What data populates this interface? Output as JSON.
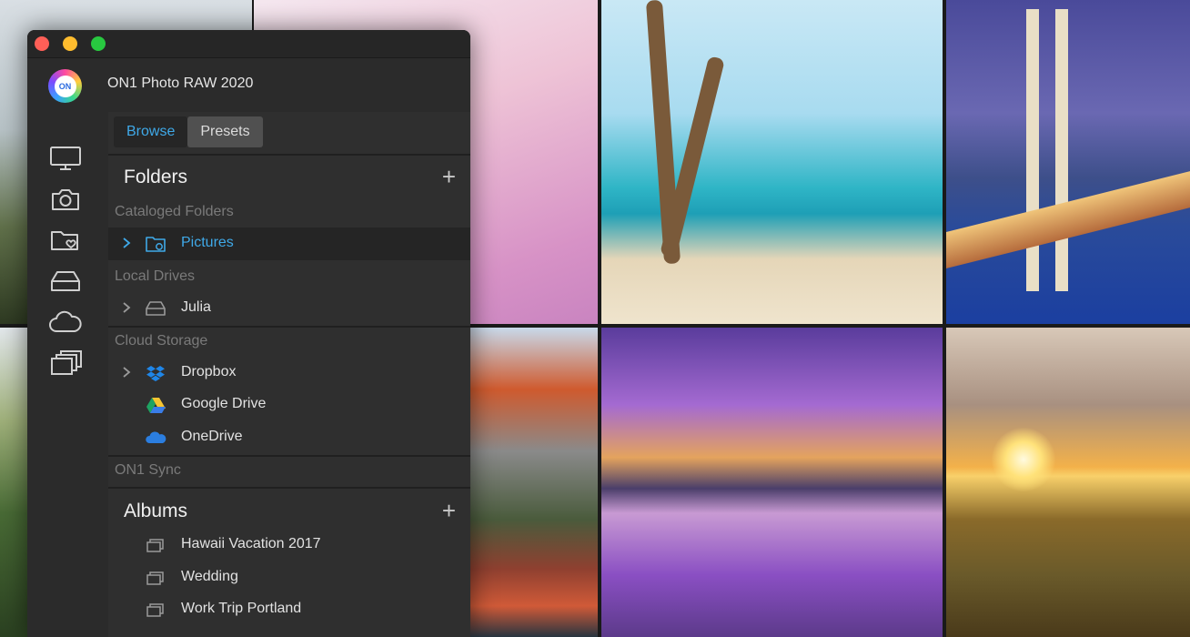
{
  "app": {
    "title": "ON1 Photo RAW 2020",
    "logo_text": "ON"
  },
  "colors": {
    "accent": "#3fa9e8",
    "window_bg": "#2b2b2b",
    "panel_bg": "#2f2f2f"
  },
  "tabs": [
    {
      "label": "Browse",
      "active": true
    },
    {
      "label": "Presets",
      "active": false
    }
  ],
  "sidebar_icons": [
    "monitor-icon",
    "camera-icon",
    "folder-heart-icon",
    "drive-icon",
    "cloud-icon",
    "albums-stack-icon"
  ],
  "folders": {
    "title": "Folders",
    "add_label": "+",
    "groups": [
      {
        "label": "Cataloged Folders",
        "items": [
          {
            "label": "Pictures",
            "icon": "folder-sync-icon",
            "selected": true,
            "expandable": true
          }
        ]
      },
      {
        "label": "Local Drives",
        "items": [
          {
            "label": "Julia",
            "icon": "drive-icon",
            "selected": false,
            "expandable": true
          }
        ]
      },
      {
        "label": "Cloud Storage",
        "items": [
          {
            "label": "Dropbox",
            "icon": "dropbox-icon",
            "selected": false,
            "expandable": true
          },
          {
            "label": "Google Drive",
            "icon": "google-drive-icon",
            "selected": false,
            "expandable": false
          },
          {
            "label": "OneDrive",
            "icon": "onedrive-icon",
            "selected": false,
            "expandable": false
          }
        ]
      },
      {
        "label": "ON1 Sync",
        "items": []
      }
    ]
  },
  "albums": {
    "title": "Albums",
    "add_label": "+",
    "items": [
      {
        "label": "Hawaii Vacation 2017",
        "icon": "album-icon"
      },
      {
        "label": "Wedding",
        "icon": "album-icon"
      },
      {
        "label": "Work Trip Portland",
        "icon": "album-icon"
      }
    ]
  }
}
